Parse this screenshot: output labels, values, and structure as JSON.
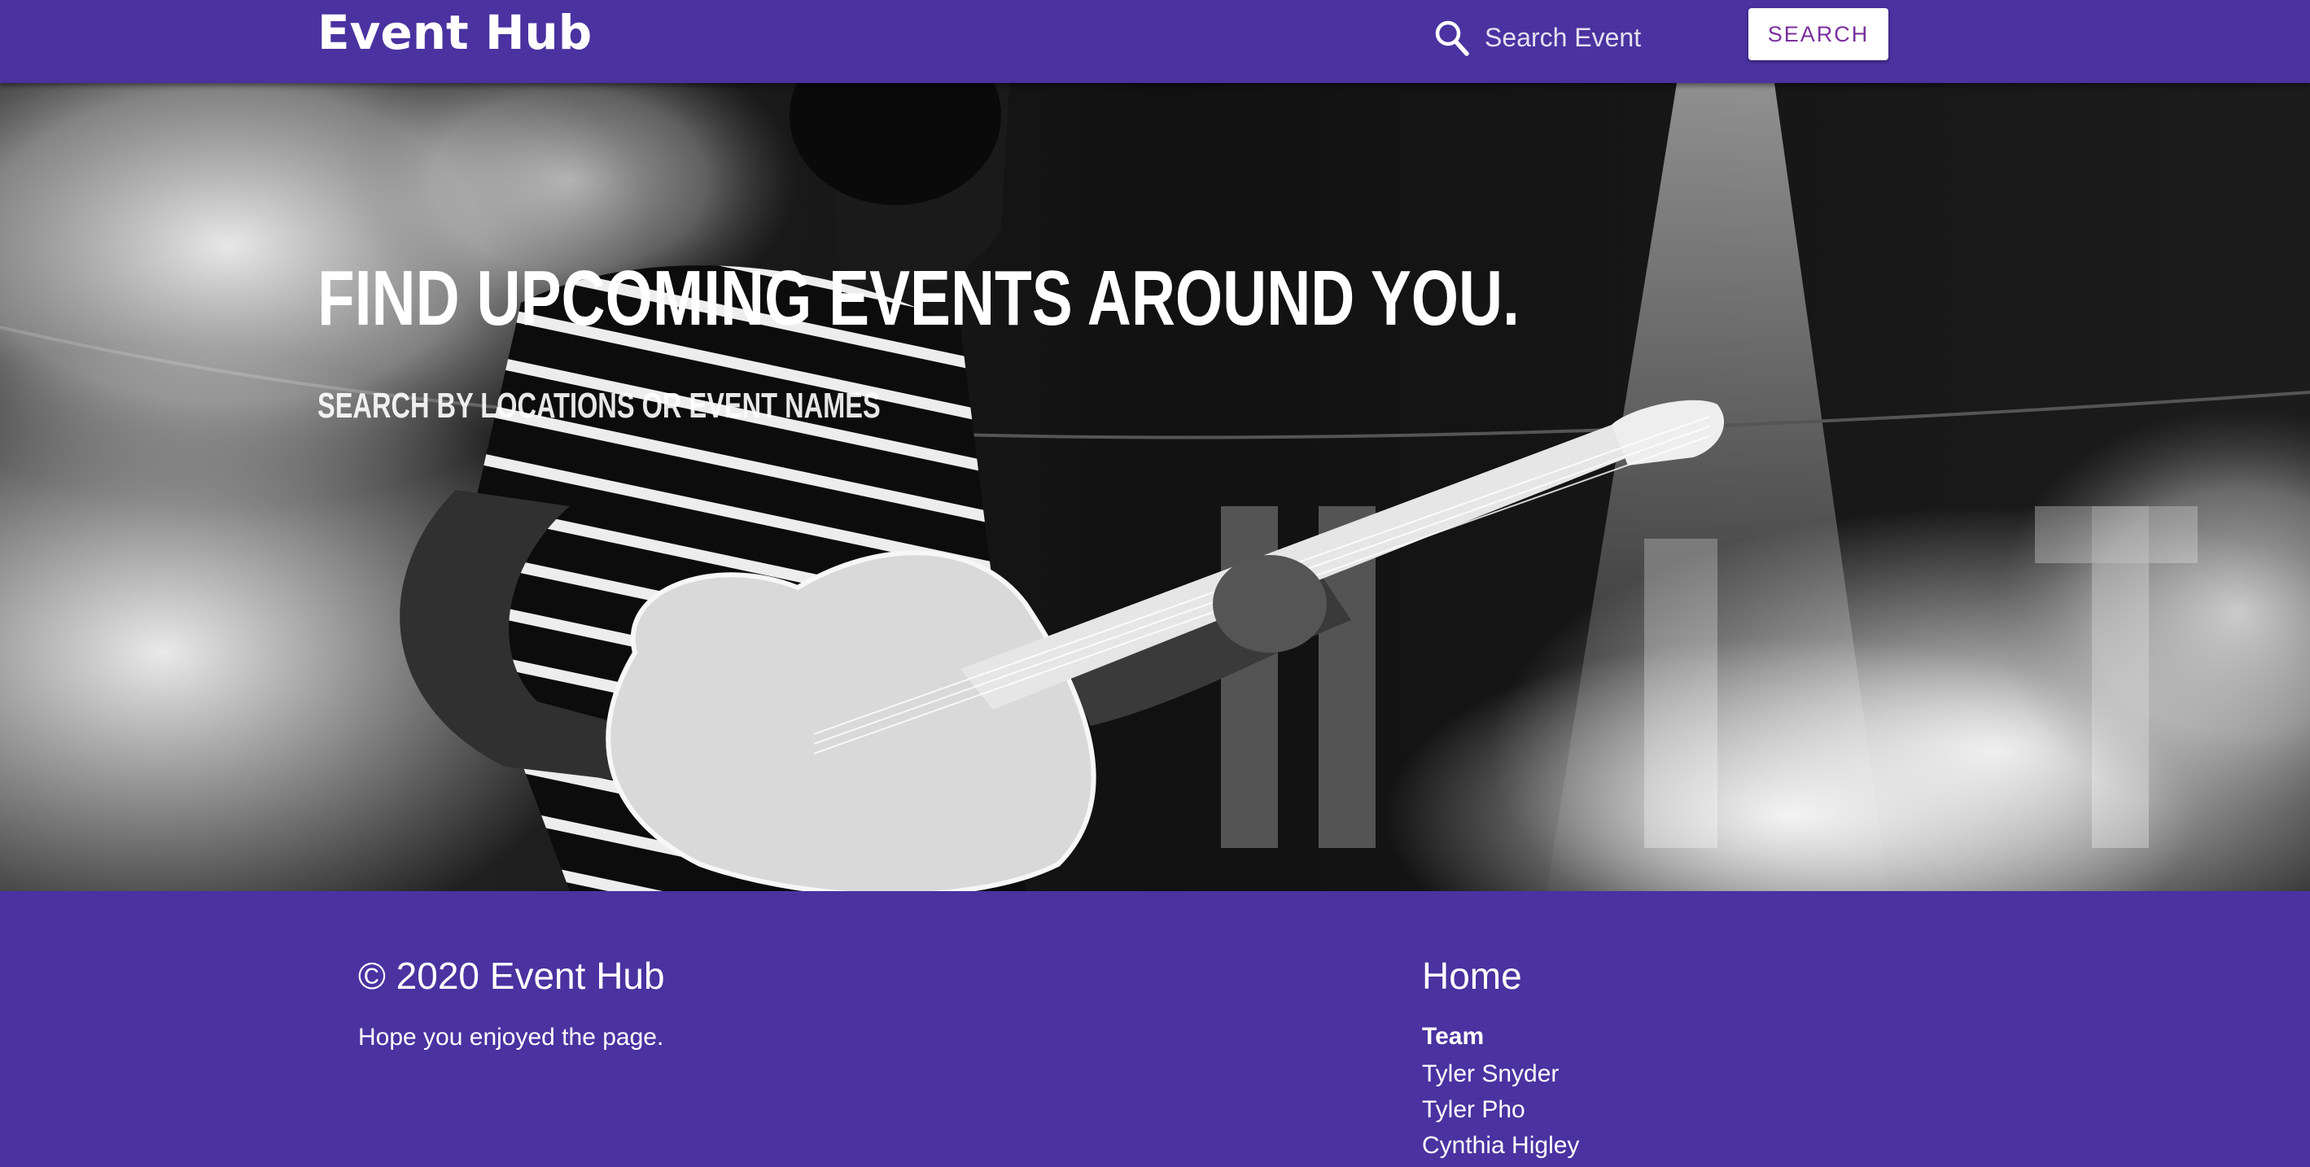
{
  "navbar": {
    "brand": "Event Hub",
    "search_placeholder": "Search Event",
    "search_button_label": "SEARCH"
  },
  "hero": {
    "title": "FIND UPCOMING EVENTS AROUND YOU.",
    "subtitle": "SEARCH BY LOCATIONS OR EVENT NAMES"
  },
  "footer": {
    "copyright": "© 2020 Event Hub",
    "tagline": "Hope you enjoyed the page.",
    "links_title": "Home",
    "team_heading": "Team",
    "team_members": [
      "Tyler Snyder",
      "Tyler Pho",
      "Cynthia Higley"
    ]
  },
  "colors": {
    "brand_purple": "#4a32a0",
    "button_text": "#7b2f9e",
    "white": "#ffffff"
  }
}
